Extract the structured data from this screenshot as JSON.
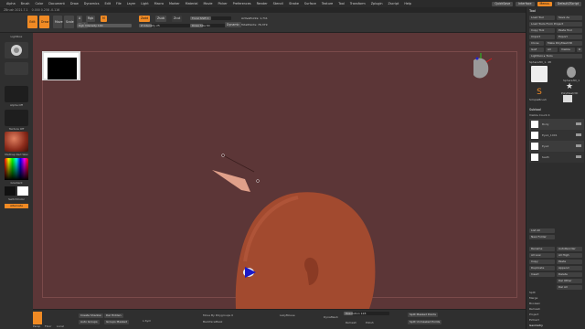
{
  "app": {
    "title": "ZBrush 2021.7.1",
    "subtitle": "0.000  0.258  -0.116"
  },
  "menu": {
    "items": [
      "Alpha",
      "Brush",
      "Color",
      "Document",
      "Draw",
      "Dynamics",
      "Edit",
      "File",
      "Layer",
      "Light",
      "Macro",
      "Marker",
      "Material",
      "Movie",
      "Picker",
      "Preferences",
      "Render",
      "Stencil",
      "Stroke",
      "Surface",
      "Texture",
      "Tool",
      "Transform",
      "Zplugin",
      "Zscript",
      "Help"
    ],
    "right": [
      "QuickSave",
      "Interface",
      "Menus",
      "DefaultZScript"
    ]
  },
  "toolbar": {
    "edit": "Edit",
    "draw": "Draw",
    "move": "Move",
    "scale": "Scale",
    "rotate": "Rotate",
    "a": "A",
    "mrgb": "Mrgb",
    "rgb": "Rgb",
    "m": "M",
    "zadd": "Zadd",
    "zsub": "Zsub",
    "zcut": "Zcut",
    "rgb_intensity": "Rgb Intensity 100",
    "z_intensity": "Z Intensity 25",
    "focal_shift": "Focal Shift 0",
    "draw_size": "Draw Size 64",
    "dynamic": "Dynamic",
    "active_points": "ActivePoints: 1,711",
    "total_points": "TotalPoints: 76,379"
  },
  "left": {
    "lightbox": "Lightbox",
    "alpha": "Alpha Off",
    "texture": "Texture Off",
    "material": "MatCap Red Wax",
    "gradient": "Gradient",
    "switch_color": "SwitchColor",
    "alternate": "Alternate"
  },
  "right": {
    "header": "Tool",
    "load_tool": "Load Tool",
    "save_as": "Save As",
    "load_from_project": "Load Tools From Project",
    "copy_tool": "Copy Tool",
    "paste_tool": "Paste Tool",
    "import": "Import",
    "export": "Export",
    "clone": "Clone",
    "make_polymesh": "Make PolyMesh3D",
    "goz": "GoZ",
    "all": "All",
    "visible": "Visible",
    "r": "R",
    "lightbox_tools": "Lightbox ▸ Tools",
    "tool_name": "Sphere3D_1. 48",
    "thumb1": "Sphere3D_1",
    "thumb2": "SimpleBrush",
    "thumb3": "PolyMesh3D",
    "subtool": "Subtool",
    "visible_count": "Visible Count 4",
    "st1": "Body",
    "st2": "Eye1_1001",
    "st3": "Eye2",
    "st4": "teeth",
    "list_all": "List All",
    "new_folder": "New Folder",
    "rename": "Rename",
    "autoreorder": "AutoReorder",
    "all_low": "All Low",
    "all_high": "All High",
    "copy": "Copy",
    "paste": "Paste",
    "duplicate": "Duplicate",
    "append": "Append",
    "insert": "Insert",
    "delete": "Delete",
    "del_other": "Del Other",
    "del_all": "Del All",
    "split": "Split",
    "merge": "Merge",
    "boolean": "Boolean",
    "remesh": "Remesh",
    "project": "Project",
    "extract": "Extract",
    "geometry": "Geometry",
    "arraymesh": "ArrayMesh",
    "nanomesh": "NanoMesh"
  },
  "bottom": {
    "persp": "Persp",
    "floor": "Floor",
    "local": "Local",
    "create_shadow": "Create Shadow",
    "auto_groups": "Auto Groups",
    "del_hidden": "Del Hidden",
    "groups_masked": "Groups Masked",
    "lsym": "L.Sym",
    "move_by_polygroups": "Move By Polygroups 0",
    "backface_mask": "BackfaceMask",
    "lazy_mouse": "LazyMouse",
    "dynamesh": "DynaMesh",
    "resolution": "Resolution 128",
    "remesh_all": "Remesh",
    "polish": "Polish",
    "split_masked": "Split Masked Points",
    "split_unmasked": "Split Unmasked Points"
  },
  "colors": {
    "accent": "#f08a24",
    "canvas": "#5c3637",
    "skin": "#a24a2f"
  }
}
